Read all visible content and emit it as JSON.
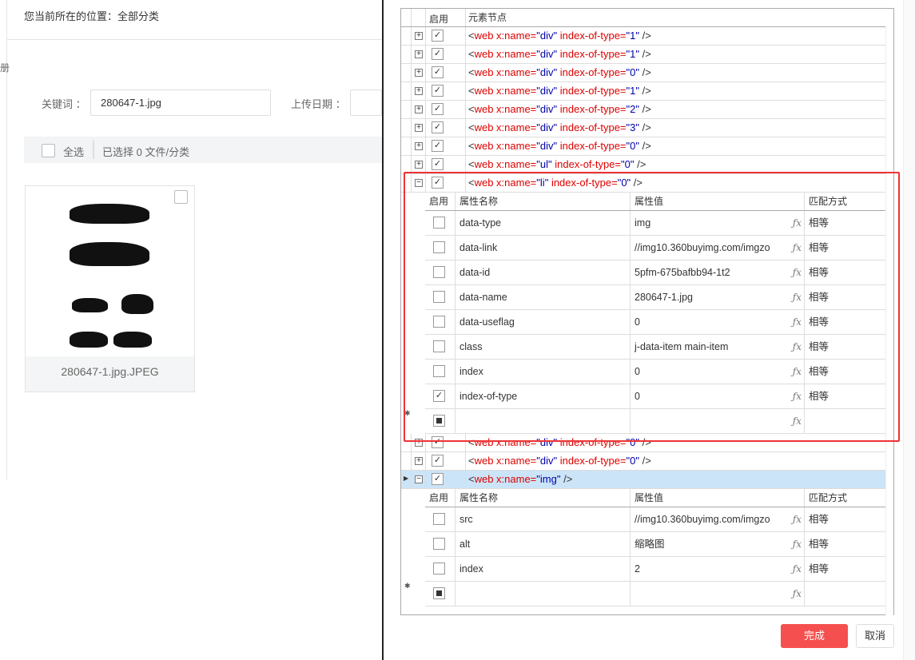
{
  "page": {
    "breadcrumb": "您当前所在的位置：全部分类",
    "side_char": "册",
    "keyword_label": "关键词 ：",
    "keyword_value": "280647-1.jpg",
    "date_label": "上传日期 ：",
    "select_all": "全选",
    "selected_info": "已选择 0 文件/分类",
    "file_name": "280647-1.jpg.JPEG"
  },
  "grid": {
    "col_enable": "启用",
    "col_node": "元素节点",
    "nodes": [
      {
        "tag": "div",
        "idx": "1"
      },
      {
        "tag": "div",
        "idx": "1"
      },
      {
        "tag": "div",
        "idx": "0"
      },
      {
        "tag": "div",
        "idx": "1"
      },
      {
        "tag": "div",
        "idx": "2"
      },
      {
        "tag": "div",
        "idx": "3"
      },
      {
        "tag": "div",
        "idx": "0"
      },
      {
        "tag": "ul",
        "idx": "0"
      },
      {
        "tag": "li",
        "idx": "0"
      },
      {
        "tag": "div",
        "idx": "0"
      },
      {
        "tag": "div",
        "idx": "0"
      },
      {
        "tag": "img"
      }
    ],
    "sub_headers": {
      "enable": "启用",
      "name": "属性名称",
      "value": "属性值",
      "match": "匹配方式"
    },
    "li_attrs": [
      {
        "name": "data-type",
        "value": "img",
        "match": "相等",
        "checked": false
      },
      {
        "name": "data-link",
        "value": "//img10.360buyimg.com/imgzo",
        "match": "相等",
        "checked": false
      },
      {
        "name": "data-id",
        "value": "5pfm-675bafbb94-1t2",
        "match": "相等",
        "checked": false
      },
      {
        "name": "data-name",
        "value": "280647-1.jpg",
        "match": "相等",
        "checked": false
      },
      {
        "name": "data-useflag",
        "value": "0",
        "match": "相等",
        "checked": false
      },
      {
        "name": "class",
        "value": "j-data-item main-item",
        "match": "相等",
        "checked": false
      },
      {
        "name": "index",
        "value": "0",
        "match": "相等",
        "checked": false
      },
      {
        "name": "index-of-type",
        "value": "0",
        "match": "相等",
        "checked": true
      }
    ],
    "img_attrs": [
      {
        "name": "src",
        "value": "//img10.360buyimg.com/imgzo",
        "match": "相等",
        "checked": false
      },
      {
        "name": "alt",
        "value": "缩略图",
        "match": "相等",
        "checked": false
      },
      {
        "name": "index",
        "value": "2",
        "match": "相等",
        "checked": false
      }
    ],
    "fx": "ƒx"
  },
  "buttons": {
    "ok": "完成",
    "cancel": "取消"
  },
  "colors": {
    "accent": "#f5504f",
    "highlight": "#e33333",
    "selected_row": "#cce4f7"
  }
}
